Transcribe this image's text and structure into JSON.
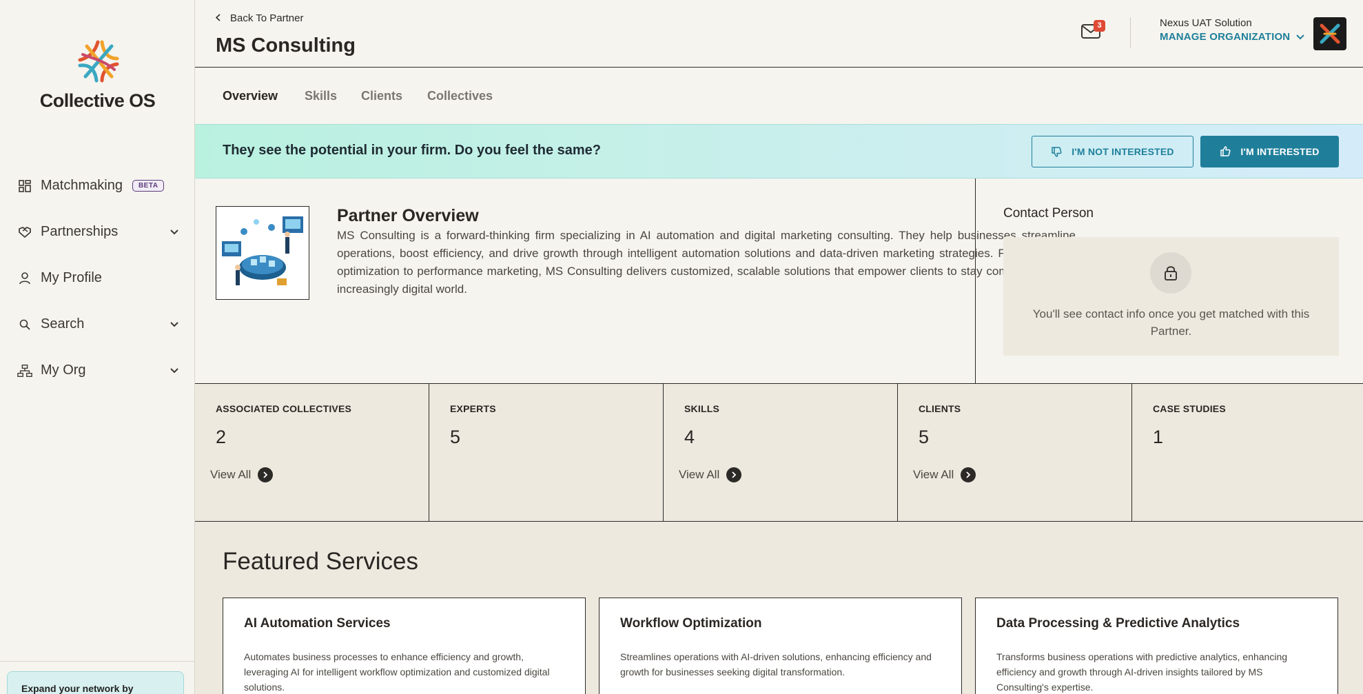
{
  "app": {
    "name": "Collective OS"
  },
  "sidebar": {
    "items": [
      {
        "label": "Matchmaking",
        "badge": "BETA",
        "icon": "grid-icon"
      },
      {
        "label": "Partnerships",
        "icon": "handshake-icon"
      },
      {
        "label": "My Profile",
        "icon": "user-icon"
      },
      {
        "label": "Search",
        "icon": "search-icon"
      },
      {
        "label": "My Org",
        "icon": "org-chart-icon"
      }
    ],
    "promo_text": "Expand your network by"
  },
  "header": {
    "back_label": "Back To Partner",
    "title": "MS Consulting",
    "notification_count": "3",
    "org_name": "Nexus UAT Solution",
    "manage_label": "MANAGE ORGANIZATION"
  },
  "tabs": [
    {
      "label": "Overview",
      "active": true
    },
    {
      "label": "Skills",
      "active": false
    },
    {
      "label": "Clients",
      "active": false
    },
    {
      "label": "Collectives",
      "active": false
    }
  ],
  "banner": {
    "text": "They see the potential in your firm. Do you feel the same?",
    "not_interested": "I'M NOT INTERESTED",
    "interested": "I'M INTERESTED"
  },
  "overview": {
    "title": "Partner Overview",
    "description": "MS Consulting is a forward-thinking firm specializing in AI automation and digital marketing consulting. They help businesses streamline operations, boost efficiency, and drive growth through intelligent automation solutions and data-driven marketing strategies. From workflow optimization to performance marketing, MS Consulting delivers customized, scalable solutions that empower clients to stay competitive in an increasingly digital world."
  },
  "contact": {
    "title": "Contact Person",
    "message": "You'll see contact info once you get matched with this Partner."
  },
  "stats": [
    {
      "label": "ASSOCIATED COLLECTIVES",
      "value": "2",
      "link": "View All"
    },
    {
      "label": "EXPERTS",
      "value": "5",
      "link": ""
    },
    {
      "label": "SKILLS",
      "value": "4",
      "link": "View All"
    },
    {
      "label": "CLIENTS",
      "value": "5",
      "link": "View All"
    },
    {
      "label": "CASE STUDIES",
      "value": "1",
      "link": ""
    }
  ],
  "featured": {
    "title": "Featured Services",
    "cards": [
      {
        "title": "AI Automation Services",
        "description": "Automates business processes to enhance efficiency and growth, leveraging AI for intelligent workflow optimization and customized digital solutions."
      },
      {
        "title": "Workflow Optimization",
        "description": "Streamlines operations with AI-driven solutions, enhancing efficiency and growth for businesses seeking digital transformation."
      },
      {
        "title": "Data Processing & Predictive Analytics",
        "description": "Transforms business operations with predictive analytics, enhancing efficiency and growth through AI-driven insights tailored by MS Consulting's expertise."
      }
    ]
  },
  "colors": {
    "accent": "#1f7f9a",
    "badge": "#e04b35",
    "text": "#2a2623"
  }
}
